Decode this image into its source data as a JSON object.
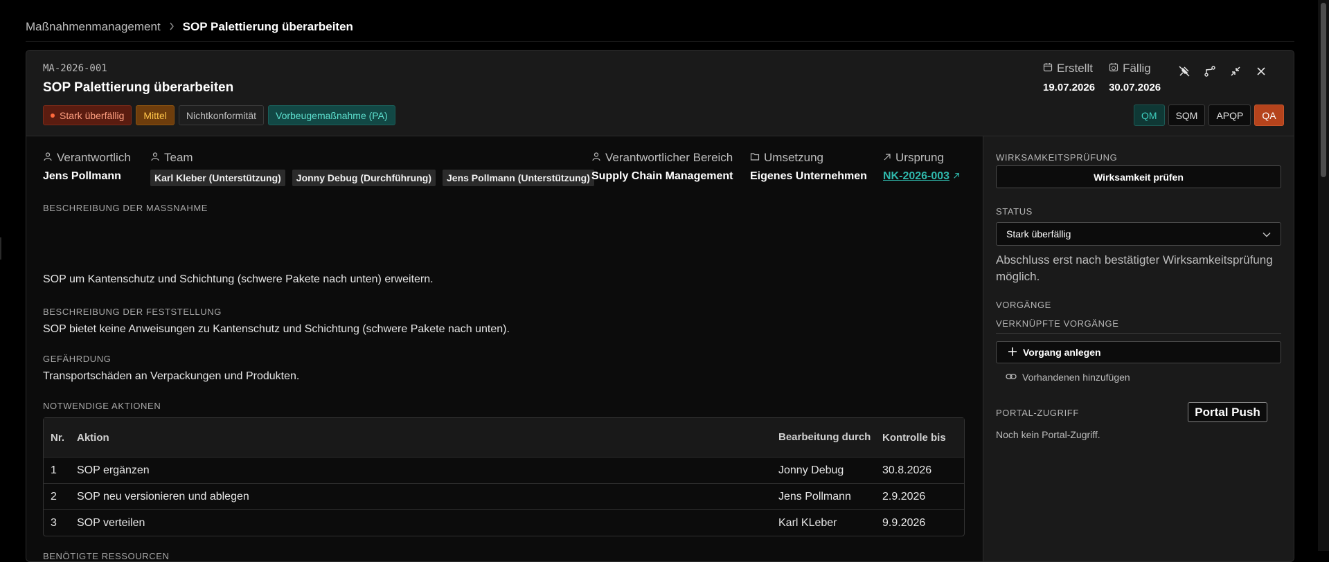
{
  "breadcrumb": {
    "parent": "Maßnahmenmanagement",
    "current": "SOP Palettierung überarbeiten"
  },
  "header": {
    "id": "MA-2026-001",
    "title": "SOP Palettierung überarbeiten",
    "badges": [
      "Stark überfällig",
      "Mittel",
      "Nichtkonformität",
      "Vorbeugemaßnahme (PA)"
    ],
    "created_label": "Erstellt",
    "created_value": "19.07.2026",
    "due_label": "Fällig",
    "due_value": "30.07.2026",
    "roles": [
      "QM",
      "SQM",
      "APQP",
      "QA"
    ],
    "icons": [
      "unpin-icon",
      "branch-icon",
      "collapse-icon",
      "close-icon"
    ]
  },
  "meta": {
    "responsible_label": "Verantwortlich",
    "responsible_value": "Jens Pollmann",
    "team_label": "Team",
    "team": [
      "Karl Kleber (Unterstützung)",
      "Jonny Debug (Durchführung)",
      "Jens Pollmann (Unterstützung)"
    ],
    "area_label": "Verantwortlicher Bereich",
    "area_value": "Supply Chain Management",
    "impl_label": "Umsetzung",
    "impl_value": "Eigenes Unternehmen",
    "origin_label": "Ursprung",
    "origin_value": "NK-2026-003"
  },
  "sections": {
    "measure_title": "BESCHREIBUNG DER MASSNAHME",
    "measure_text": "SOP um Kantenschutz und Schichtung (schwere Pakete nach unten) erweitern.",
    "finding_title": "BESCHREIBUNG DER FESTSTELLUNG",
    "finding_text": "SOP bietet keine Anweisungen zu Kantenschutz und Schichtung (schwere Pakete nach unten).",
    "hazard_title": "GEFÄHRDUNG",
    "hazard_text": "Transportschäden an Verpackungen und Produkten.",
    "actions_title": "NOTWENDIGE AKTIONEN",
    "resources_title": "BENÖTIGTE RESSOURCEN",
    "resources_text": "—"
  },
  "actions_table": {
    "headers": [
      "Nr.",
      "Aktion",
      "Bearbeitung durch",
      "Kontrolle bis"
    ],
    "rows": [
      [
        "1",
        "SOP ergänzen",
        "Jonny Debug",
        "30.8.2026"
      ],
      [
        "2",
        "SOP neu versionieren und ablegen",
        "Jens Pollmann",
        "2.9.2026"
      ],
      [
        "3",
        "SOP verteilen",
        "Karl KLeber",
        "9.9.2026"
      ]
    ]
  },
  "sidebar": {
    "effectiveness_title": "WIRKSAMKEITSPRÜFUNG",
    "effectiveness_button": "Wirksamkeit prüfen",
    "status_title": "STATUS",
    "status_value": "Stark überfällig",
    "status_hint": "Abschluss erst nach bestätigter Wirksamkeitsprüfung möglich.",
    "processes_title": "VORGÄNGE",
    "linked_title": "VERKNÜPFTE VORGÄNGE",
    "create_button": "Vorgang anlegen",
    "add_existing": "Vorhandenen hinzufügen",
    "portal_title": "PORTAL-ZUGRIFF",
    "portal_button": "Portal Push",
    "portal_text": "Noch kein Portal-Zugriff."
  }
}
